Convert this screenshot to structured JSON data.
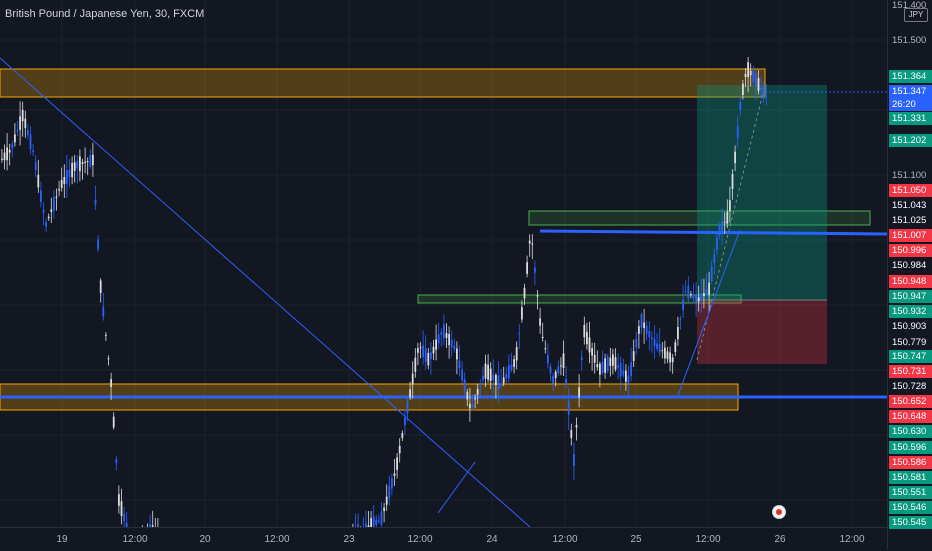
{
  "header": {
    "symbol": "British Pound / Japanese Yen, 30, FXCM"
  },
  "price_axis": {
    "currency": "JPY",
    "ticks": [
      "151.400",
      "151.500",
      "151.100"
    ],
    "tags": [
      {
        "price": "151.364",
        "bg": "#089981"
      },
      {
        "price": "151.347",
        "bg": "#2962ff",
        "sub": "26:20"
      },
      {
        "price": "151.331",
        "bg": "#089981"
      },
      {
        "price": "151.202",
        "bg": "#089981"
      },
      {
        "price": "151.050",
        "bg": "#f23645"
      },
      {
        "price": "151.043",
        "bg": "#131722"
      },
      {
        "price": "151.025",
        "bg": "#131722"
      },
      {
        "price": "151.007",
        "bg": "#f23645"
      },
      {
        "price": "150.996",
        "bg": "#f23645"
      },
      {
        "price": "150.984",
        "bg": "#131722"
      },
      {
        "price": "150.948",
        "bg": "#f23645"
      },
      {
        "price": "150.947",
        "bg": "#089981"
      },
      {
        "price": "150.932",
        "bg": "#089981"
      },
      {
        "price": "150.903",
        "bg": "#131722"
      },
      {
        "price": "150.779",
        "bg": "#131722"
      },
      {
        "price": "150.747",
        "bg": "#089981"
      },
      {
        "price": "150.731",
        "bg": "#f23645"
      },
      {
        "price": "150.728",
        "bg": "#131722"
      },
      {
        "price": "150.652",
        "bg": "#f23645"
      },
      {
        "price": "150.648",
        "bg": "#f23645"
      },
      {
        "price": "150.630",
        "bg": "#089981"
      },
      {
        "price": "150.596",
        "bg": "#089981"
      },
      {
        "price": "150.586",
        "bg": "#f23645"
      },
      {
        "price": "150.581",
        "bg": "#089981"
      },
      {
        "price": "150.551",
        "bg": "#089981"
      },
      {
        "price": "150.546",
        "bg": "#089981"
      },
      {
        "price": "150.545",
        "bg": "#089981"
      }
    ]
  },
  "time_axis": {
    "labels": [
      "19",
      "12:00",
      "20",
      "12:00",
      "23",
      "12:00",
      "24",
      "12:00",
      "25",
      "12:00",
      "26",
      "12:00"
    ]
  },
  "colors": {
    "background": "#131722",
    "candle": "#2962ff",
    "zone_orange": "#f7a600",
    "zone_green": "#4caf50",
    "profit": "#089981",
    "loss": "#f23645",
    "line_blue": "#2962ff"
  }
}
